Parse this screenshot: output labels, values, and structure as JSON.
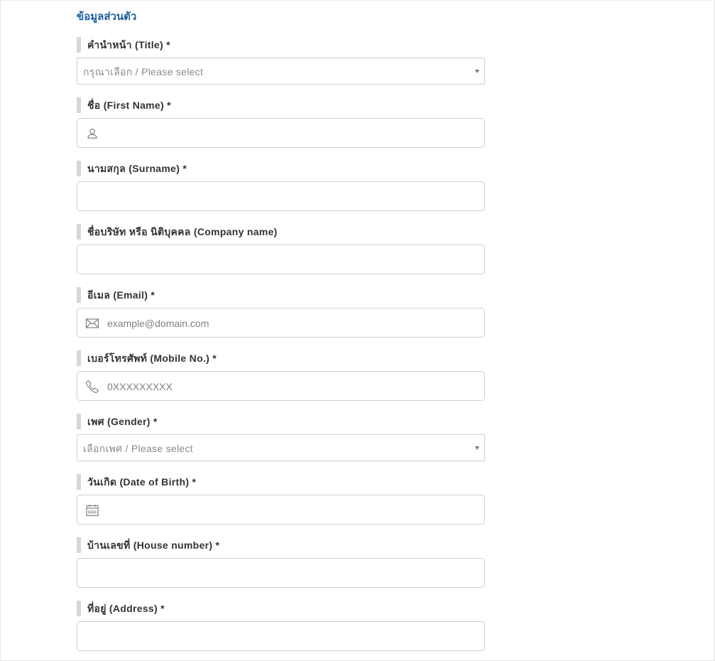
{
  "section": {
    "title": "ข้อมูลส่วนตัว"
  },
  "fields": {
    "title": {
      "label": "คำนำหน้า (Title) *",
      "selected": "กรุณาเลือก / Please select"
    },
    "first_name": {
      "label": "ชื่อ (First Name) *",
      "value": "",
      "icon": "user-icon"
    },
    "surname": {
      "label": "นามสกุล (Surname) *",
      "value": ""
    },
    "company": {
      "label": "ชื่อบริษัท หรือ นิติบุคคล (Company name)",
      "value": ""
    },
    "email": {
      "label": "อีเมล (Email) *",
      "placeholder": "example@domain.com",
      "icon": "envelope-icon"
    },
    "mobile": {
      "label": "เบอร์โทรศัพท์ (Mobile No.) *",
      "placeholder": "0XXXXXXXXX",
      "icon": "phone-icon"
    },
    "gender": {
      "label": "เพศ (Gender) *",
      "selected": "เลือกเพศ / Please select"
    },
    "dob": {
      "label": "วันเกิด (Date of Birth) *",
      "value": "",
      "icon": "calendar-icon"
    },
    "house_number": {
      "label": "บ้านเลขที่ (House number) *",
      "value": ""
    },
    "address": {
      "label": "ที่อยู่ (Address) *",
      "value": ""
    }
  },
  "colors": {
    "section_title": "#1b5c9e",
    "label_text": "#333333",
    "label_bar": "#d7d7d7",
    "input_border": "#cfcfcf",
    "placeholder": "#808080"
  }
}
